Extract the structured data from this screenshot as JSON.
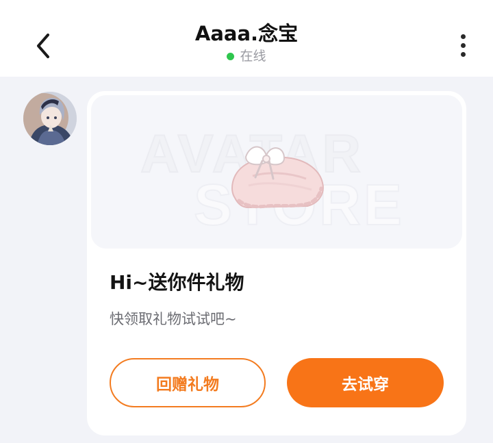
{
  "header": {
    "title": "Aaaa.念宝",
    "status": "在线",
    "status_color": "#2fc64e",
    "back_icon": "chevron-left-icon",
    "more_icon": "more-vertical-icon"
  },
  "message": {
    "avatar": "user-avatar",
    "watermark_top": "AVATAR",
    "watermark_bottom": "STORE",
    "gift_image": "pink-bow-cushion",
    "title": "Hi~送你件礼物",
    "subtitle": "快领取礼物试试吧~",
    "buttons": {
      "return_gift": "回赠礼物",
      "try_on": "去试穿"
    },
    "accent_color": "#f87417"
  }
}
